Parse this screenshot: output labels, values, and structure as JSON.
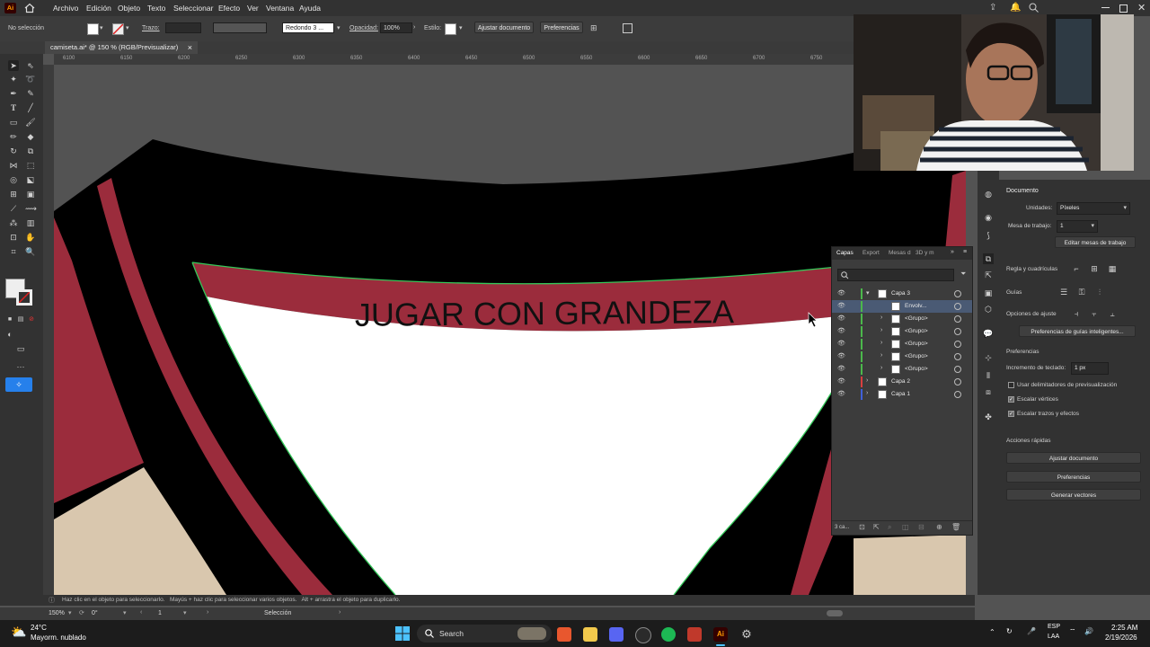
{
  "menubar": {
    "app_icon": "Ai",
    "items": [
      "Archivo",
      "Edición",
      "Objeto",
      "Texto",
      "Seleccionar",
      "Efecto",
      "Ver",
      "Ventana",
      "Ayuda"
    ]
  },
  "controlbar": {
    "selection_status": "No selección",
    "stroke_label": "Trazo:",
    "brush_label": "Redondo 3 ...",
    "opacity_label": "Opacidad:",
    "opacity_value": "100%",
    "style_label": "Estilo:",
    "fit_document_btn": "Ajustar documento",
    "preferences_btn": "Preferencias"
  },
  "document": {
    "tab_title": "camiseta.ai* @ 150 % (RGB/Previsualizar)",
    "close_glyph": "×"
  },
  "ruler": {
    "ticks": [
      "6100",
      "6150",
      "6200",
      "6250",
      "6300",
      "6350",
      "6400",
      "6450",
      "6500",
      "6550",
      "6600",
      "6650",
      "6700",
      "6750"
    ]
  },
  "artwork": {
    "text": "JUGAR CON GRANDEZA",
    "colors": {
      "shirt_black": "#000000",
      "stripe_red": "#9b2c3c",
      "fabric_beige": "#d9c7ae",
      "inner_white": "#ffffff",
      "selection_green": "#34c759"
    }
  },
  "layers_panel": {
    "tabs": [
      "Capas",
      "Export",
      "Mesas d",
      "3D y m"
    ],
    "rows": [
      {
        "name": "Capa 3",
        "color": "#4bb84b",
        "expanded": true
      },
      {
        "name": "Envolv...",
        "color": "#4bb84b",
        "selected": true
      },
      {
        "name": "<Grupo>",
        "color": "#4bb84b"
      },
      {
        "name": "<Grupo>",
        "color": "#4bb84b"
      },
      {
        "name": "<Grupo>",
        "color": "#4bb84b"
      },
      {
        "name": "<Grupo>",
        "color": "#4bb84b"
      },
      {
        "name": "<Grupo>",
        "color": "#4bb84b"
      },
      {
        "name": "Capa 2",
        "color": "#d94040"
      },
      {
        "name": "Capa 1",
        "color": "#4060d9"
      }
    ],
    "footer_count": "3 ca..."
  },
  "properties": {
    "section_title": "Documento",
    "units_label": "Unidades:",
    "units_value": "Píxeles",
    "artboard_label": "Mesa de trabajo:",
    "artboard_value": "1",
    "edit_artboards_btn": "Editar mesas de trabajo",
    "rulers_grids_label": "Regla y cuadrículas",
    "guides_label": "Guías",
    "snap_options_label": "Opciones de ajuste",
    "smart_guides_btn": "Preferencias de guías inteligentes...",
    "preferences_section": "Preferencias",
    "keyboard_increment_label": "Incremento de teclado:",
    "keyboard_increment_value": "1 px",
    "chk_preview_bounds": "Usar delimitadores de previsualización",
    "chk_scale_corners": "Escalar vértices",
    "chk_scale_strokes": "Escalar trazos y efectos",
    "quick_actions_label": "Acciones rápidas",
    "quick_fit_document": "Ajustar documento",
    "quick_preferences": "Preferencias",
    "quick_generate_vectors": "Generar vectores"
  },
  "statusbar": {
    "hint": "Haz clic en el objeto para seleccionarlo.   Mayús + haz clic para seleccionar varios objetos.   Alt + arrastra el objeto para duplicarlo.",
    "zoom": "150%",
    "rotation": "0°",
    "artboard_nav": "1",
    "tool_name": "Selección"
  },
  "taskbar": {
    "weather_temp": "24°C",
    "weather_desc": "Mayorm. nublado",
    "search_placeholder": "Search",
    "lang_top": "ESP",
    "lang_bottom": "LAA",
    "time": "2:25 AM",
    "date": "2/19/2026"
  }
}
